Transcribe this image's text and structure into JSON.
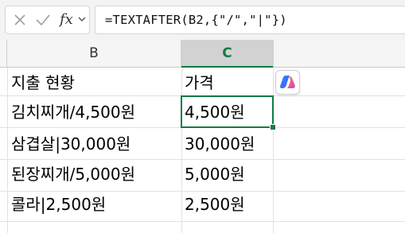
{
  "formula_bar": {
    "cancel_icon": "close-icon",
    "enter_icon": "checkmark-icon",
    "fx_label": "fx",
    "dropdown_icon": "chevron-down-icon",
    "formula": "=TEXTAFTER(B2,{\"/\",\"|\"})"
  },
  "columns": {
    "b": "B",
    "c": "C"
  },
  "rows": [
    {
      "b": "지출 현황",
      "c": "가격"
    },
    {
      "b": "김치찌개/4,500원",
      "c": "4,500원"
    },
    {
      "b": "삼겹살|30,000원",
      "c": "30,000원"
    },
    {
      "b": "된장찌개/5,000원",
      "c": "5,000원"
    },
    {
      "b": "콜라|2,500원",
      "c": "2,500원"
    }
  ],
  "copilot_icon": "copilot-icon",
  "colors": {
    "accent": "#107c41"
  }
}
